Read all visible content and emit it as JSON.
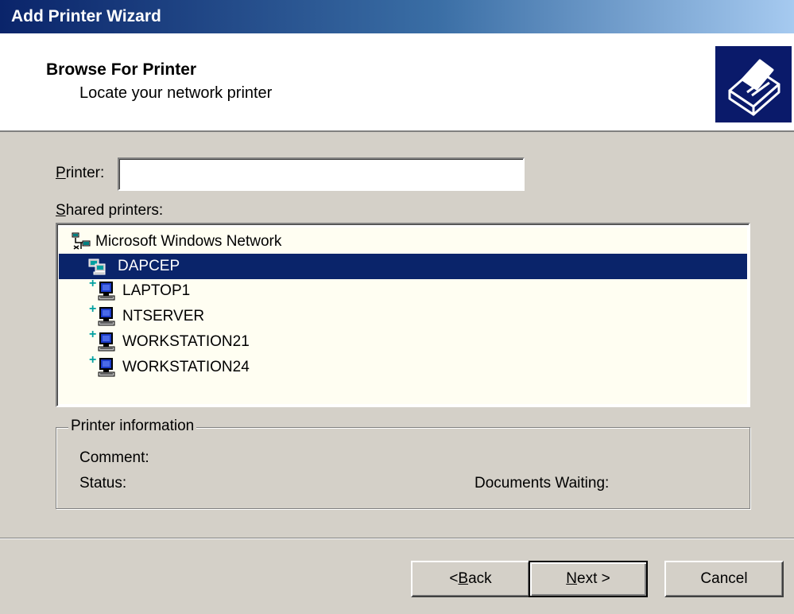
{
  "window": {
    "title": "Add Printer Wizard"
  },
  "header": {
    "title": "Browse For Printer",
    "subtitle": "Locate your network printer",
    "icon": "printer-icon"
  },
  "printer_field": {
    "label_mnemonic": "P",
    "label_rest": "rinter:",
    "value": "",
    "placeholder": ""
  },
  "shared_printers": {
    "label_mnemonic": "S",
    "label_rest": "hared printers:",
    "tree": [
      {
        "label": "Microsoft Windows Network",
        "icon": "network-icon",
        "level": 0,
        "selected": false,
        "expandable": false
      },
      {
        "label": "DAPCEP",
        "icon": "workgroup-icon",
        "level": 1,
        "selected": true,
        "expandable": false
      },
      {
        "label": "LAPTOP1",
        "icon": "computer-icon",
        "level": 2,
        "selected": false,
        "expandable": true
      },
      {
        "label": "NTSERVER",
        "icon": "computer-icon",
        "level": 2,
        "selected": false,
        "expandable": true
      },
      {
        "label": "WORKSTATION21",
        "icon": "computer-icon",
        "level": 2,
        "selected": false,
        "expandable": true
      },
      {
        "label": "WORKSTATION24",
        "icon": "computer-icon",
        "level": 2,
        "selected": false,
        "expandable": true
      }
    ]
  },
  "printer_information": {
    "legend": "Printer information",
    "comment_label": "Comment:",
    "status_label": "Status:",
    "documents_waiting_label": "Documents Waiting:"
  },
  "buttons": {
    "back_prefix": "< ",
    "back_mnemonic": "B",
    "back_rest": "ack",
    "next_mnemonic": "N",
    "next_rest": "ext >",
    "cancel": "Cancel"
  },
  "colors": {
    "title_bar": "#0a246a",
    "selection": "#0a246a",
    "face": "#d4d0c8"
  }
}
